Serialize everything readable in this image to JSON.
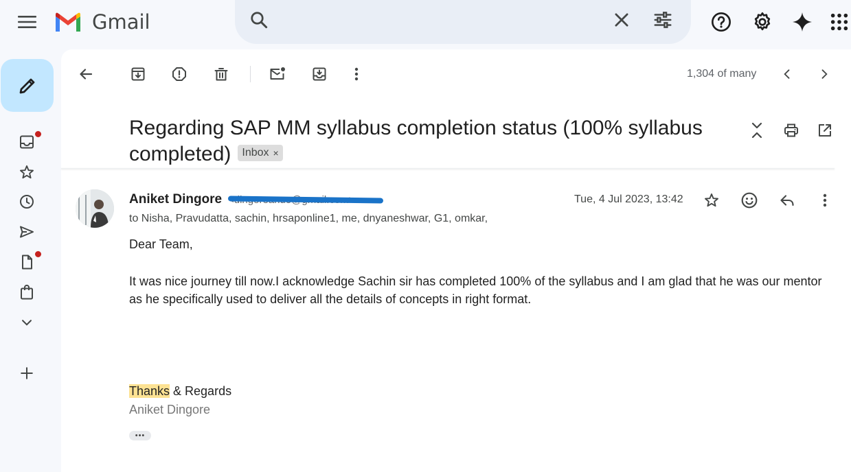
{
  "header": {
    "app_name": "Gmail",
    "logo_colors": {
      "red": "#EA4335",
      "blue": "#4285F4",
      "green": "#34A853",
      "yellow": "#FBBC04",
      "dark_red": "#C5221F"
    }
  },
  "toolbar": {
    "pager_text": "1,304 of many"
  },
  "email": {
    "subject": "Regarding SAP MM syllabus completion status (100% syllabus completed)",
    "label": "Inbox",
    "label_remove": "×",
    "sender_name": "Aniket Dingore",
    "sender_email": "<dingoreanuo@gmail.com>",
    "recipients": "to Nisha, Pravudatta, sachin, hrsaponline1, me, dnyaneshwar, G1, omkar,",
    "date": "Tue, 4 Jul 2023, 13:42",
    "greeting": "Dear Team,",
    "body": "It was nice journey till now.I acknowledge Sachin sir has completed 100% of the syllabus and I am glad that he was our mentor as he specifically used to deliver all the details of concepts in right format.",
    "thanks_highlight": "Thanks",
    "thanks_rest": " & Regards",
    "signature": "Aniket Dingore",
    "trimmed_dots": "•••"
  },
  "colors": {
    "compose_bg": "#c2e7ff",
    "badge_red": "#c5221f",
    "highlight": "#fde293",
    "redaction": "#1a73c8"
  }
}
